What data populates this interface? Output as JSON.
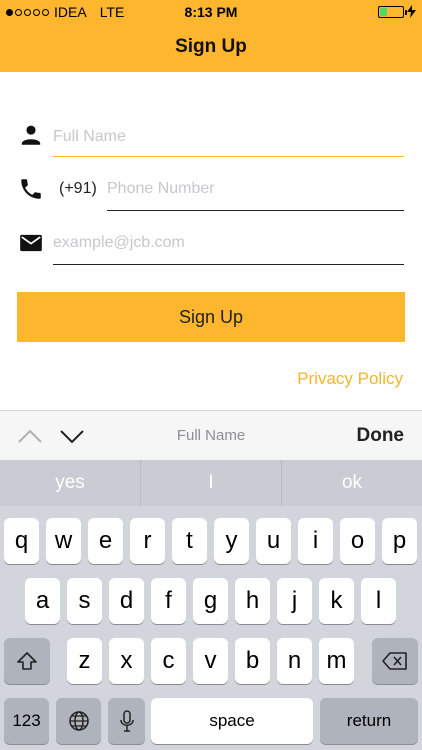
{
  "status": {
    "carrier": "IDEA",
    "network": "LTE",
    "time": "8:13 PM",
    "signal_filled": 1,
    "signal_total": 5,
    "battery_level": 0.3,
    "charging": true
  },
  "nav": {
    "title": "Sign Up"
  },
  "form": {
    "full_name": {
      "placeholder": "Full Name",
      "value": "",
      "icon": "person-icon"
    },
    "phone": {
      "prefix": "(+91)",
      "placeholder": "Phone Number",
      "value": "",
      "icon": "phone-icon"
    },
    "email": {
      "placeholder": "example@jcb.com",
      "value": "",
      "icon": "envelope-icon"
    },
    "submit_label": "Sign Up",
    "privacy_label": "Privacy Policy"
  },
  "accessory": {
    "field_label": "Full Name",
    "done_label": "Done"
  },
  "keyboard": {
    "suggestions": [
      "yes",
      "I",
      "ok"
    ],
    "row1": [
      "q",
      "w",
      "e",
      "r",
      "t",
      "y",
      "u",
      "i",
      "o",
      "p"
    ],
    "row2": [
      "a",
      "s",
      "d",
      "f",
      "g",
      "h",
      "j",
      "k",
      "l"
    ],
    "row3": [
      "z",
      "x",
      "c",
      "v",
      "b",
      "n",
      "m"
    ],
    "numbers_label": "123",
    "space_label": "space",
    "return_label": "return"
  },
  "colors": {
    "accent": "#FDB62D",
    "link": "#F2B62A",
    "focus_line": "#FDB62D"
  }
}
